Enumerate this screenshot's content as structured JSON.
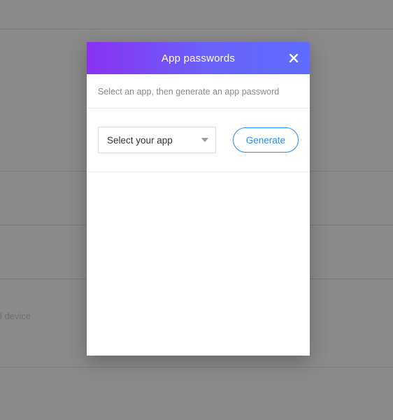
{
  "background": {
    "device_label_fragment": "l device"
  },
  "modal": {
    "title": "App passwords",
    "subtitle": "Select an app, then generate an app password",
    "select": {
      "placeholder": "Select your app"
    },
    "generate_label": "Generate"
  }
}
